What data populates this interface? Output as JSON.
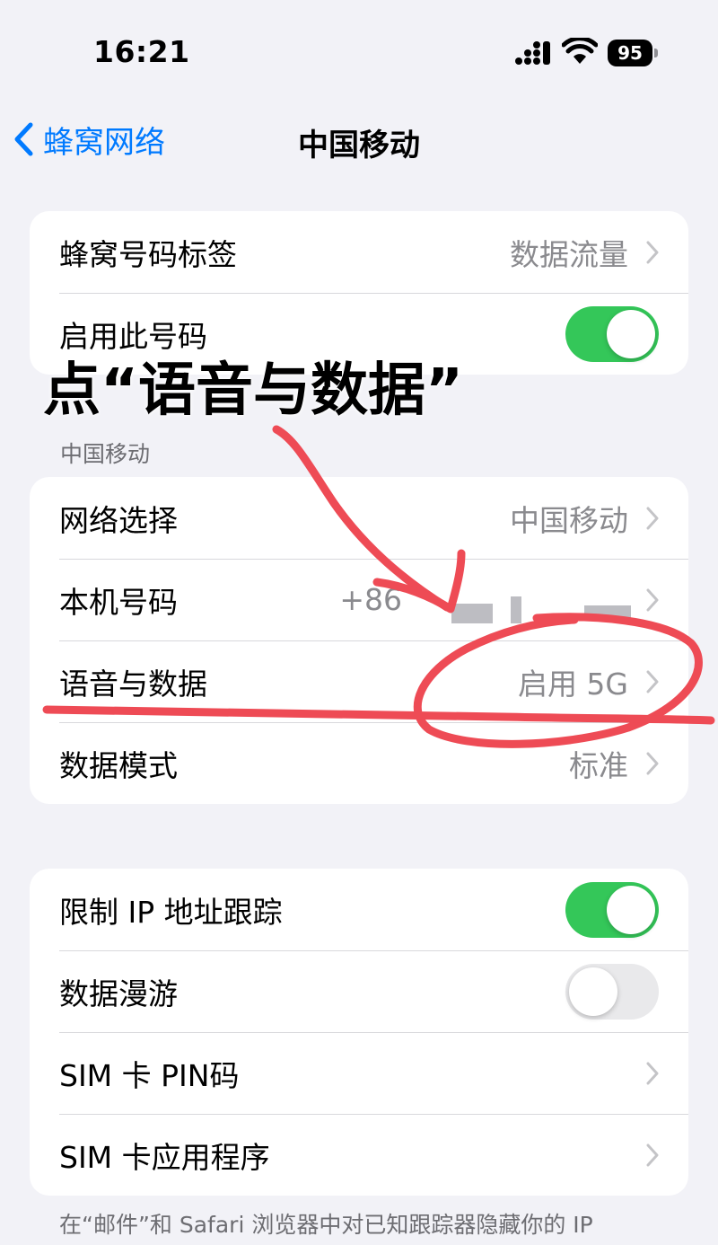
{
  "status_bar": {
    "time": "16:21",
    "battery": "95",
    "signal_icon": "signal-bars-icon",
    "wifi_icon": "wifi-icon"
  },
  "nav": {
    "back_label": "蜂窝网络",
    "title": "中国移动"
  },
  "group1": {
    "row1": {
      "label": "蜂窝号码标签",
      "value": "数据流量"
    },
    "row2": {
      "label": "启用此号码",
      "toggle": true
    }
  },
  "section_header": "中国移动",
  "group2": {
    "row1": {
      "label": "网络选择",
      "value": "中国移动"
    },
    "row2": {
      "label": "本机号码",
      "value": "+86"
    },
    "row3": {
      "label": "语音与数据",
      "value": "启用 5G"
    },
    "row4": {
      "label": "数据模式",
      "value": "标准"
    }
  },
  "group3": {
    "row1": {
      "label": "限制 IP 地址跟踪",
      "toggle": true
    },
    "row2": {
      "label": "数据漫游",
      "toggle": false
    },
    "row3": {
      "label": "SIM 卡 PIN码"
    },
    "row4": {
      "label": "SIM 卡应用程序"
    }
  },
  "footer_note": "在“邮件”和 Safari 浏览器中对已知跟踪器隐藏你的 IP",
  "annotation": {
    "text": "点“语音与数据”",
    "color": "#ee4b55"
  },
  "colors": {
    "accent": "#007aff",
    "toggle_on": "#34c759",
    "background": "#f2f2f7"
  }
}
